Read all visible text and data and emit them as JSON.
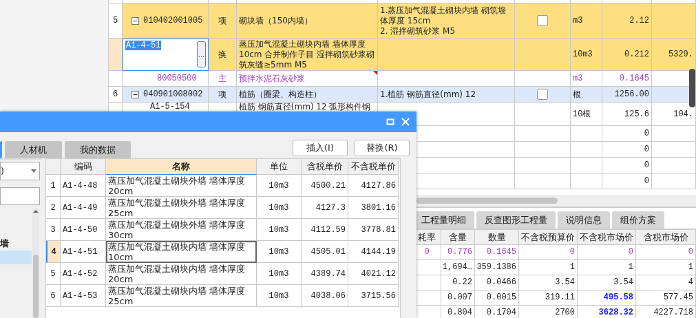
{
  "main_table": {
    "rows": [
      {
        "kind": "top"
      },
      {
        "kind": "item",
        "selected": true,
        "number": "5",
        "expanded": true,
        "code": "010402001005",
        "type": "项",
        "name": "砌块墙（150内墙）",
        "feature": "1.蒸压加气混凝土砌块内墙 砌筑墙体厚度 15cm\n2. 湿拌砌筑砂浆 M5",
        "checked": false,
        "unit": "m3",
        "quantity": "2.12"
      },
      {
        "kind": "quota",
        "selected": true,
        "editing": true,
        "code": "A1-4-51",
        "edit_button": "…",
        "type": "换",
        "name": "蒸压加气混凝土砌块内墙 墙体厚度 10cm  合并制作子目 湿拌砌筑砂浆砌筑灰缝≥5mm M5",
        "unit": "10m3",
        "quantity": "0.212",
        "price": "5329."
      },
      {
        "kind": "material",
        "selected": false,
        "has_note": true,
        "code": "80050500",
        "type": "主",
        "name": "预拌水泥石灰砂浆",
        "unit": "m3",
        "quantity": "0.1645"
      },
      {
        "kind": "item",
        "selected": false,
        "number": "6",
        "expanded": true,
        "code": "040901008002",
        "type": "项",
        "name": "植筋（圈梁、构造柱）",
        "feature": "1.植筋 钢筋直径(mm) 12",
        "checked": false,
        "unit": "根",
        "quantity": "1256.00"
      },
      {
        "kind": "quota",
        "selected": false,
        "editing": false,
        "code": "A1-5-154",
        "name": "植筋 钢筋直径(mm) 12  弧形构件钢",
        "unit": "10根",
        "quantity": "125.6",
        "price": "104."
      },
      {
        "kind": "blank",
        "quantity": "0"
      },
      {
        "kind": "blank",
        "quantity": "0"
      },
      {
        "kind": "blank",
        "quantity": "0"
      },
      {
        "kind": "blank",
        "quantity": "0"
      }
    ]
  },
  "bottom_panel": {
    "tabs": [
      {
        "label": "工程量明细",
        "selected": false
      },
      {
        "label": "反查图形工程量",
        "selected": false
      },
      {
        "label": "说明信息",
        "selected": false
      },
      {
        "label": "组价方案",
        "selected": false
      }
    ],
    "columns": [
      "耗率",
      "含量",
      "数量",
      "不含税预算价",
      "不含税市场价",
      "含税市场价"
    ],
    "rows": [
      {
        "kind": "material",
        "market_price_changed": false,
        "cells": [
          "0",
          "0.776",
          "0.1645",
          "0",
          "0",
          "0"
        ]
      },
      {
        "kind": "normal",
        "market_price_changed": false,
        "cells": [
          "",
          "1,694…",
          "359.1386",
          "1",
          "1",
          "1"
        ]
      },
      {
        "kind": "normal",
        "market_price_changed": false,
        "cells": [
          "",
          "0.22",
          "0.0466",
          "3.54",
          "3.54",
          "4"
        ]
      },
      {
        "kind": "normal",
        "market_price_changed": true,
        "cells": [
          "",
          "0.007",
          "0.0015",
          "319.11",
          "495.58",
          "577.45"
        ]
      },
      {
        "kind": "normal",
        "market_price_changed": true,
        "cells": [
          "",
          "0.804",
          "0.1704",
          "2700",
          "3628.32",
          "4227.718"
        ]
      }
    ]
  },
  "dialog": {
    "tabs": [
      {
        "selected": true
      },
      {
        "label": "人材机",
        "selected": false
      },
      {
        "label": "我的数据",
        "selected": false
      }
    ],
    "buttons": [
      "插入(I)",
      "替换(R)"
    ],
    "dropdown": {
      "value": ")"
    },
    "tree": [
      {
        "label": "墙",
        "selected": false
      },
      {
        "selected": true
      }
    ],
    "grid": {
      "columns": [
        {
          "label": "编码",
          "selected": false
        },
        {
          "label": "名称",
          "selected": true
        },
        {
          "label": "单位",
          "selected": false
        },
        {
          "label": "含税单价",
          "selected": false
        },
        {
          "label": "不含税单价",
          "selected": false
        }
      ],
      "rows": [
        {
          "number": "1",
          "code": "A1-4-48",
          "name": "蒸压加气混凝土砌块外墙 墙体厚度 20cm",
          "unit": "10m3",
          "price_with_tax": "4500.21",
          "price_without_tax": "4127.86",
          "selected": false
        },
        {
          "number": "2",
          "code": "A1-4-49",
          "name": "蒸压加气混凝土砌块外墙 墙体厚度 25cm",
          "unit": "10m3",
          "price_with_tax": "4127.3",
          "price_without_tax": "3801.16",
          "selected": false
        },
        {
          "number": "3",
          "code": "A1-4-50",
          "name": "蒸压加气混凝土砌块外墙 墙体厚度 30cm",
          "unit": "10m3",
          "price_with_tax": "4112.59",
          "price_without_tax": "3778.81",
          "selected": false
        },
        {
          "number": "4",
          "code": "A1-4-51",
          "name": "蒸压加气混凝土砌块内墙 墙体厚度 10cm",
          "unit": "10m3",
          "price_with_tax": "4505.01",
          "price_without_tax": "4144.19",
          "selected": true
        },
        {
          "number": "5",
          "code": "A1-4-52",
          "name": "蒸压加气混凝土砌块内墙 墙体厚度 20cm",
          "unit": "10m3",
          "price_with_tax": "4389.74",
          "price_without_tax": "4021.12",
          "selected": false
        },
        {
          "number": "6",
          "code": "A1-4-53",
          "name": "蒸压加气混凝土砌块内墙 墙体厚度 25cm",
          "unit": "10m3",
          "price_with_tax": "4038.06",
          "price_without_tax": "3715.56",
          "selected": false
        }
      ]
    }
  }
}
